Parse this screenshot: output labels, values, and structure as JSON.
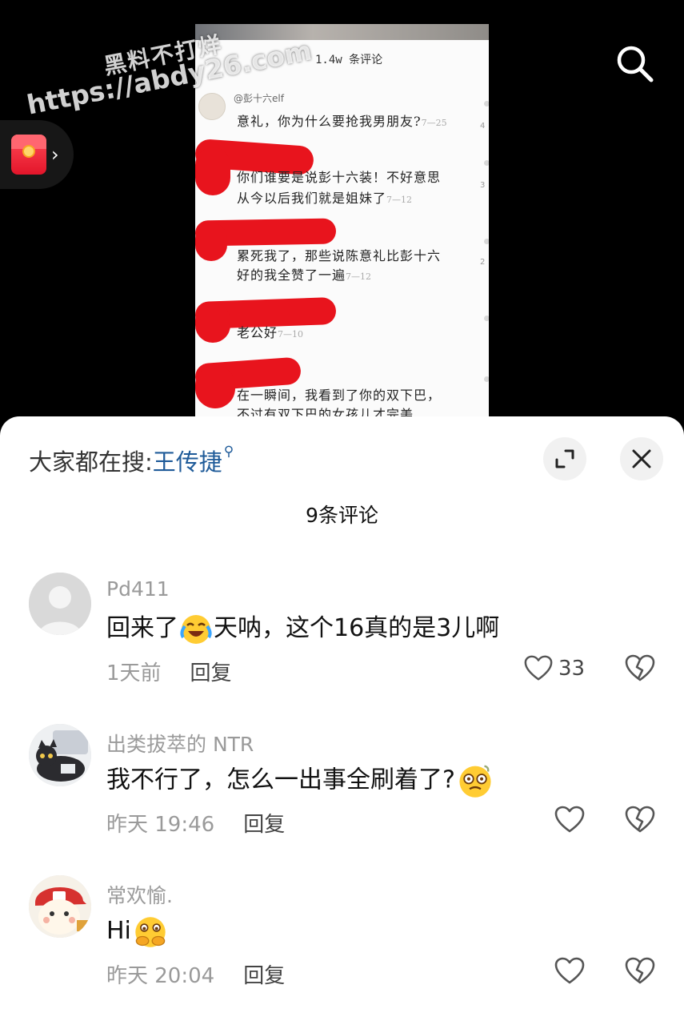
{
  "video": {
    "screenshot": {
      "title": "1.4w 条评论",
      "user": "@彭十六elf",
      "comments": [
        {
          "text": "意礼，你为什么要抢我男朋友?",
          "date": "7—25",
          "side": "4"
        },
        {
          "text": "你们谁要是说彭十六装！不好意思",
          "date": "",
          "side": "3"
        },
        {
          "text": "从今以后我们就是姐妹了",
          "date": "7—12",
          "side": ""
        },
        {
          "text": "累死我了，那些说陈意礼比彭十六",
          "date": "",
          "side": "2"
        },
        {
          "text": "好的我全赞了一遍",
          "date": "7—12",
          "side": ""
        },
        {
          "text": "老公好",
          "date": "7—10",
          "side": ""
        },
        {
          "text": "在一瞬间，我看到了你的双下巴，",
          "date": "",
          "side": ""
        },
        {
          "text": "不过有双下巴的女孩儿才完美",
          "date": "",
          "side": ""
        }
      ]
    },
    "watermark": {
      "line1": "黑料不打烊",
      "line2": "https://abdy26.com"
    },
    "search_icon": "search-icon",
    "red_packet_icon": "red-envelope-icon"
  },
  "sheet": {
    "hot_search_prefix": "大家都在搜:",
    "hot_search_term": "王传捷",
    "count_label": "9条评论",
    "comments": [
      {
        "username": "Pd411",
        "text_before": "回来了",
        "emoji": "laughing-crying-emoji",
        "text_after": "天呐，这个16真的是3儿啊",
        "time": "1天前",
        "reply": "回复",
        "likes": "33"
      },
      {
        "username": "出类拔萃的 NTR",
        "text_before": "我不行了，怎么一出事全刷着了?",
        "emoji": "dizzy-face-emoji",
        "text_after": "",
        "time": "昨天 19:46",
        "reply": "回复",
        "likes": ""
      },
      {
        "username": "常欢愉.",
        "text_before": "Hi",
        "emoji": "shy-face-emoji",
        "text_after": "",
        "time": "昨天 20:04",
        "reply": "回复",
        "likes": ""
      }
    ]
  },
  "colors": {
    "link": "#1f5b99",
    "scribble": "#e8141d",
    "red_packet": "#e3152a"
  }
}
